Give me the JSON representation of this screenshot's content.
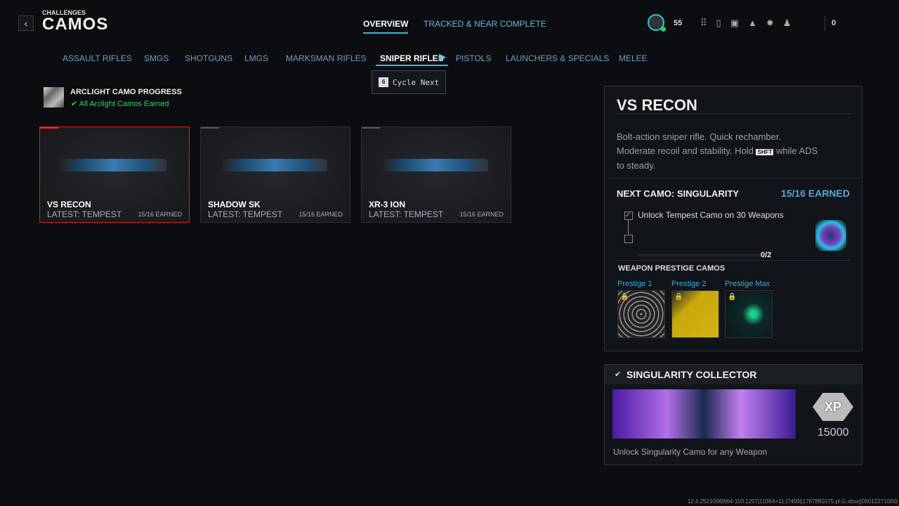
{
  "header": {
    "breadcrumb": "CHALLENGES",
    "title": "CAMOS",
    "tabs": [
      "OVERVIEW",
      "TRACKED & NEAR COMPLETE"
    ],
    "level": "55",
    "friends_count": "0"
  },
  "categories": [
    "ASSAULT RIFLES",
    "SMGS",
    "SHOTGUNS",
    "LMGS",
    "MARKSMAN RIFLES",
    "SNIPER RIFLES",
    "PISTOLS",
    "LAUNCHERS & SPECIALS",
    "MELEE"
  ],
  "cycle": {
    "key": "G",
    "label": "Cycle Next"
  },
  "arclight": {
    "title": "ARCLIGHT CAMO PROGRESS",
    "status": "All Arclight Camos Earned"
  },
  "weapons": [
    {
      "name": "VS RECON",
      "latest": "LATEST: TEMPEST",
      "earned": "15/16 EARNED"
    },
    {
      "name": "SHADOW SK",
      "latest": "LATEST: TEMPEST",
      "earned": "15/16 EARNED"
    },
    {
      "name": "XR-3 ION",
      "latest": "LATEST: TEMPEST",
      "earned": "15/16 EARNED"
    }
  ],
  "detail": {
    "name": "VS RECON",
    "desc1": "Bolt-action sniper rifle.  Quick rechamber.",
    "desc2a": "Moderate recoil and stability.  Hold",
    "key": "SHFT",
    "desc2b": "while ADS",
    "desc3": "to steady.",
    "next_camo": "NEXT CAMO: SINGULARITY",
    "earned": "15/16 EARNED",
    "challenge": "Unlock Tempest Camo on 30 Weapons",
    "progress": "0/2",
    "progress_fraction": 0,
    "prestige_title": "WEAPON PRESTIGE CAMOS",
    "prestige": [
      "Prestige 1",
      "Prestige 2",
      "Prestige Max"
    ]
  },
  "reward": {
    "title": "SINGULARITY COLLECTOR",
    "xp_label": "XP",
    "xp": "15000",
    "desc": "Unlock Singularity Camo for any Weapon"
  },
  "build": "12.4.25210069|64-103.1207|10364+11:|7400||1767891075.pl.G.xbsx||00012271000|"
}
